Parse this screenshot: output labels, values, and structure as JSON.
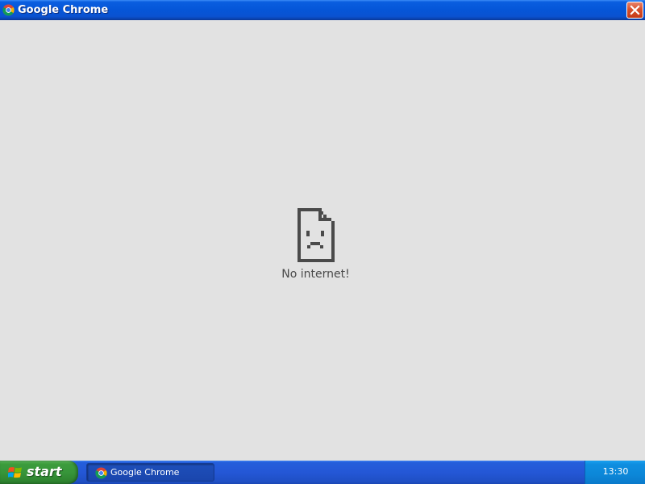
{
  "window": {
    "title": "Google Chrome",
    "icon": "chrome-icon",
    "close_icon": "close-icon"
  },
  "page": {
    "error_icon": "sad-document-icon",
    "message": "No internet!"
  },
  "taskbar": {
    "start_label": "start",
    "start_icon": "windows-logo-icon",
    "tasks": [
      {
        "label": "Google Chrome",
        "icon": "chrome-icon"
      }
    ],
    "clock": "13:30"
  },
  "colors": {
    "titlebar": "#0556d8",
    "close_button": "#d8502c",
    "content_background": "#e2e2e2",
    "start_button": "#37953a",
    "taskbar": "#2457d6",
    "tray": "#0c87d8"
  }
}
